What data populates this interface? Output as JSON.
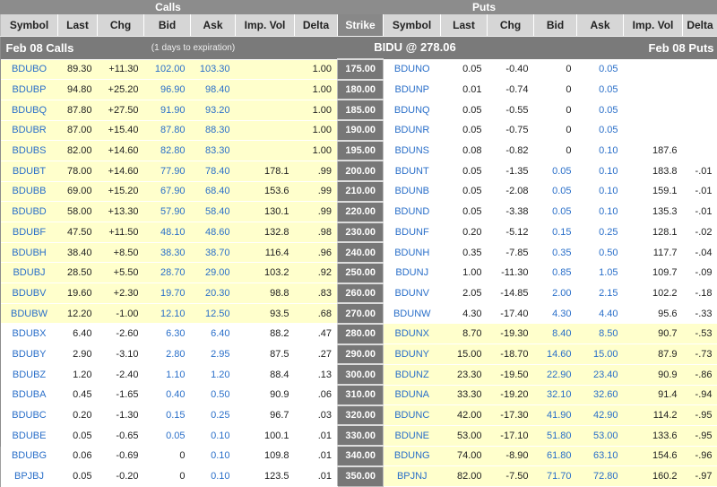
{
  "sections": {
    "calls": "Calls",
    "puts": "Puts"
  },
  "columns": {
    "call": [
      "Symbol",
      "Last",
      "Chg",
      "Bid",
      "Ask",
      "Imp. Vol",
      "Delta"
    ],
    "strike": "Strike",
    "put": [
      "Symbol",
      "Last",
      "Chg",
      "Bid",
      "Ask",
      "Imp. Vol",
      "Delta"
    ]
  },
  "info": {
    "calls_label": "Feb 08 Calls",
    "expiration": "(1 days to expiration)",
    "underlying": "BIDU @ 278.06",
    "puts_label": "Feb 08 Puts"
  },
  "colors": {
    "itm": "#ffffcc",
    "link": "#2a6fc9",
    "strike_bg": "#777777"
  },
  "rows": [
    {
      "strike": "175.00",
      "call": [
        "BDUBO",
        "89.30",
        "+11.30",
        "102.00",
        "103.30",
        "",
        "1.00"
      ],
      "put": [
        "BDUNO",
        "0.05",
        "-0.40",
        "0",
        "0.05",
        "",
        ""
      ],
      "call_itm": true
    },
    {
      "strike": "180.00",
      "call": [
        "BDUBP",
        "94.80",
        "+25.20",
        "96.90",
        "98.40",
        "",
        "1.00"
      ],
      "put": [
        "BDUNP",
        "0.01",
        "-0.74",
        "0",
        "0.05",
        "",
        ""
      ],
      "call_itm": true
    },
    {
      "strike": "185.00",
      "call": [
        "BDUBQ",
        "87.80",
        "+27.50",
        "91.90",
        "93.20",
        "",
        "1.00"
      ],
      "put": [
        "BDUNQ",
        "0.05",
        "-0.55",
        "0",
        "0.05",
        "",
        ""
      ],
      "call_itm": true
    },
    {
      "strike": "190.00",
      "call": [
        "BDUBR",
        "87.00",
        "+15.40",
        "87.80",
        "88.30",
        "",
        "1.00"
      ],
      "put": [
        "BDUNR",
        "0.05",
        "-0.75",
        "0",
        "0.05",
        "",
        ""
      ],
      "call_itm": true
    },
    {
      "strike": "195.00",
      "call": [
        "BDUBS",
        "82.00",
        "+14.60",
        "82.80",
        "83.30",
        "",
        "1.00"
      ],
      "put": [
        "BDUNS",
        "0.08",
        "-0.82",
        "0",
        "0.10",
        "187.6",
        ""
      ],
      "call_itm": true
    },
    {
      "strike": "200.00",
      "call": [
        "BDUBT",
        "78.00",
        "+14.60",
        "77.90",
        "78.40",
        "178.1",
        ".99"
      ],
      "put": [
        "BDUNT",
        "0.05",
        "-1.35",
        "0.05",
        "0.10",
        "183.8",
        "-.01"
      ],
      "call_itm": true
    },
    {
      "strike": "210.00",
      "call": [
        "BDUBB",
        "69.00",
        "+15.20",
        "67.90",
        "68.40",
        "153.6",
        ".99"
      ],
      "put": [
        "BDUNB",
        "0.05",
        "-2.08",
        "0.05",
        "0.10",
        "159.1",
        "-.01"
      ],
      "call_itm": true
    },
    {
      "strike": "220.00",
      "call": [
        "BDUBD",
        "58.00",
        "+13.30",
        "57.90",
        "58.40",
        "130.1",
        ".99"
      ],
      "put": [
        "BDUND",
        "0.05",
        "-3.38",
        "0.05",
        "0.10",
        "135.3",
        "-.01"
      ],
      "call_itm": true
    },
    {
      "strike": "230.00",
      "call": [
        "BDUBF",
        "47.50",
        "+11.50",
        "48.10",
        "48.60",
        "132.8",
        ".98"
      ],
      "put": [
        "BDUNF",
        "0.20",
        "-5.12",
        "0.15",
        "0.25",
        "128.1",
        "-.02"
      ],
      "call_itm": true
    },
    {
      "strike": "240.00",
      "call": [
        "BDUBH",
        "38.40",
        "+8.50",
        "38.30",
        "38.70",
        "116.4",
        ".96"
      ],
      "put": [
        "BDUNH",
        "0.35",
        "-7.85",
        "0.35",
        "0.50",
        "117.7",
        "-.04"
      ],
      "call_itm": true
    },
    {
      "strike": "250.00",
      "call": [
        "BDUBJ",
        "28.50",
        "+5.50",
        "28.70",
        "29.00",
        "103.2",
        ".92"
      ],
      "put": [
        "BDUNJ",
        "1.00",
        "-11.30",
        "0.85",
        "1.05",
        "109.7",
        "-.09"
      ],
      "call_itm": true
    },
    {
      "strike": "260.00",
      "call": [
        "BDUBV",
        "19.60",
        "+2.30",
        "19.70",
        "20.30",
        "98.8",
        ".83"
      ],
      "put": [
        "BDUNV",
        "2.05",
        "-14.85",
        "2.00",
        "2.15",
        "102.2",
        "-.18"
      ],
      "call_itm": true
    },
    {
      "strike": "270.00",
      "call": [
        "BDUBW",
        "12.20",
        "-1.00",
        "12.10",
        "12.50",
        "93.5",
        ".68"
      ],
      "put": [
        "BDUNW",
        "4.30",
        "-17.40",
        "4.30",
        "4.40",
        "95.6",
        "-.33"
      ],
      "call_itm": true
    },
    {
      "strike": "280.00",
      "call": [
        "BDUBX",
        "6.40",
        "-2.60",
        "6.30",
        "6.40",
        "88.2",
        ".47"
      ],
      "put": [
        "BDUNX",
        "8.70",
        "-19.30",
        "8.40",
        "8.50",
        "90.7",
        "-.53"
      ],
      "call_itm": false
    },
    {
      "strike": "290.00",
      "call": [
        "BDUBY",
        "2.90",
        "-3.10",
        "2.80",
        "2.95",
        "87.5",
        ".27"
      ],
      "put": [
        "BDUNY",
        "15.00",
        "-18.70",
        "14.60",
        "15.00",
        "87.9",
        "-.73"
      ],
      "call_itm": false
    },
    {
      "strike": "300.00",
      "call": [
        "BDUBZ",
        "1.20",
        "-2.40",
        "1.10",
        "1.20",
        "88.4",
        ".13"
      ],
      "put": [
        "BDUNZ",
        "23.30",
        "-19.50",
        "22.90",
        "23.40",
        "90.9",
        "-.86"
      ],
      "call_itm": false
    },
    {
      "strike": "310.00",
      "call": [
        "BDUBA",
        "0.45",
        "-1.65",
        "0.40",
        "0.50",
        "90.9",
        ".06"
      ],
      "put": [
        "BDUNA",
        "33.30",
        "-19.20",
        "32.10",
        "32.60",
        "91.4",
        "-.94"
      ],
      "call_itm": false
    },
    {
      "strike": "320.00",
      "call": [
        "BDUBC",
        "0.20",
        "-1.30",
        "0.15",
        "0.25",
        "96.7",
        ".03"
      ],
      "put": [
        "BDUNC",
        "42.00",
        "-17.30",
        "41.90",
        "42.90",
        "114.2",
        "-.95"
      ],
      "call_itm": false
    },
    {
      "strike": "330.00",
      "call": [
        "BDUBE",
        "0.05",
        "-0.65",
        "0.05",
        "0.10",
        "100.1",
        ".01"
      ],
      "put": [
        "BDUNE",
        "53.00",
        "-17.10",
        "51.80",
        "53.00",
        "133.6",
        "-.95"
      ],
      "call_itm": false
    },
    {
      "strike": "340.00",
      "call": [
        "BDUBG",
        "0.06",
        "-0.69",
        "0",
        "0.10",
        "109.8",
        ".01"
      ],
      "put": [
        "BDUNG",
        "74.00",
        "-8.90",
        "61.80",
        "63.10",
        "154.6",
        "-.96"
      ],
      "call_itm": false
    },
    {
      "strike": "350.00",
      "call": [
        "BPJBJ",
        "0.05",
        "-0.20",
        "0",
        "0.10",
        "123.5",
        ".01"
      ],
      "put": [
        "BPJNJ",
        "82.00",
        "-7.50",
        "71.70",
        "72.80",
        "160.2",
        "-.97"
      ],
      "call_itm": false
    }
  ]
}
